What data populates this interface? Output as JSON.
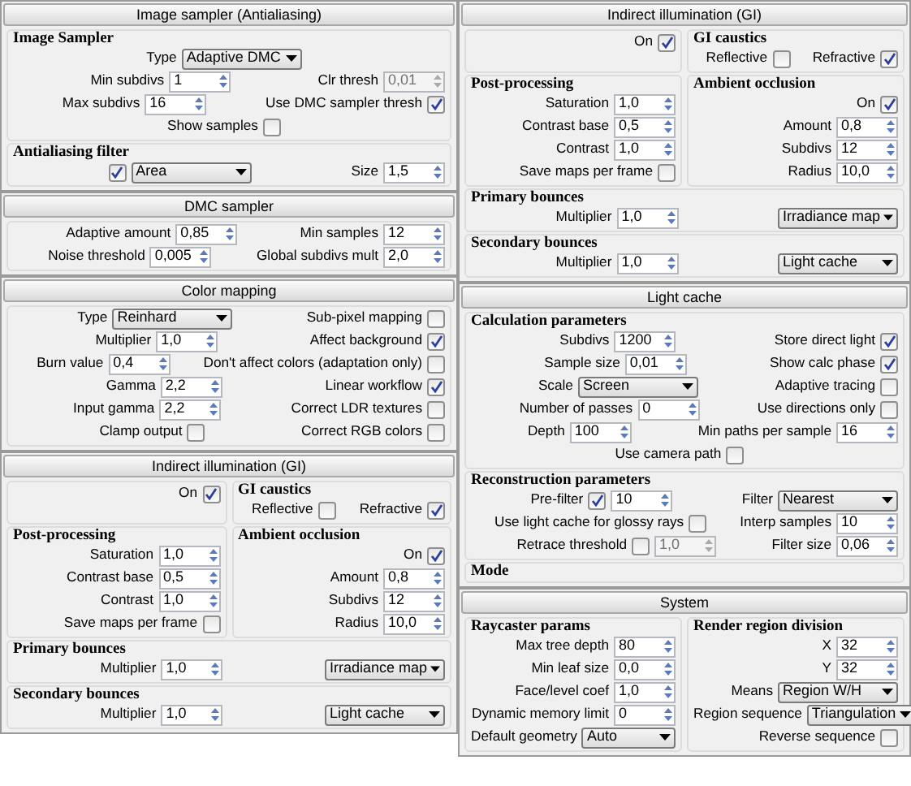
{
  "columns": [
    {
      "rollouts": [
        {
          "title": "Image sampler (Antialiasing)",
          "sections": [
            {
              "groups": [
                {
                  "title": "Image Sampler",
                  "rows": [
                    [
                      {
                        "label": "Type",
                        "controls": [
                          {
                            "kind": "combo",
                            "value": "Adaptive DMC"
                          }
                        ]
                      }
                    ],
                    [
                      {
                        "label": "Min subdivs",
                        "controls": [
                          {
                            "kind": "spin",
                            "value": "1"
                          }
                        ]
                      },
                      {
                        "label": "Clr thresh",
                        "controls": [
                          {
                            "kind": "spin",
                            "value": "0,01",
                            "disabled": true
                          }
                        ]
                      }
                    ],
                    [
                      {
                        "label": "Max subdivs",
                        "controls": [
                          {
                            "kind": "spin",
                            "value": "16"
                          }
                        ]
                      },
                      {
                        "label": "Use DMC sampler thresh",
                        "controls": [
                          {
                            "kind": "check",
                            "checked": true
                          }
                        ]
                      }
                    ],
                    [
                      {
                        "label": "Show samples",
                        "controls": [
                          {
                            "kind": "check",
                            "checked": false
                          }
                        ]
                      }
                    ]
                  ]
                }
              ]
            },
            {
              "groups": [
                {
                  "title": "Antialiasing filter",
                  "rows": [
                    [
                      {
                        "controls": [
                          {
                            "kind": "check",
                            "checked": true
                          },
                          {
                            "kind": "combo",
                            "value": "Area"
                          }
                        ]
                      },
                      {
                        "label": "Size",
                        "controls": [
                          {
                            "kind": "spin",
                            "value": "1,5"
                          }
                        ]
                      }
                    ]
                  ]
                }
              ]
            }
          ]
        },
        {
          "title": "DMC sampler",
          "sections": [
            {
              "groups": [
                {
                  "rows": [
                    [
                      {
                        "label": "Adaptive amount",
                        "controls": [
                          {
                            "kind": "spin",
                            "value": "0,85"
                          }
                        ]
                      },
                      {
                        "label": "Min samples",
                        "controls": [
                          {
                            "kind": "spin",
                            "value": "12"
                          }
                        ]
                      }
                    ],
                    [
                      {
                        "label": "Noise threshold",
                        "controls": [
                          {
                            "kind": "spin",
                            "value": "0,005"
                          }
                        ]
                      },
                      {
                        "label": "Global subdivs mult",
                        "controls": [
                          {
                            "kind": "spin",
                            "value": "2,0"
                          }
                        ]
                      }
                    ]
                  ]
                }
              ]
            }
          ]
        },
        {
          "title": "Color mapping",
          "sections": [
            {
              "groups": [
                {
                  "rows": [
                    [
                      {
                        "label": "Type",
                        "controls": [
                          {
                            "kind": "combo",
                            "value": "Reinhard"
                          }
                        ]
                      },
                      {
                        "label": "Sub-pixel mapping",
                        "controls": [
                          {
                            "kind": "check",
                            "checked": false
                          }
                        ]
                      }
                    ],
                    [
                      {
                        "label": "Multiplier",
                        "controls": [
                          {
                            "kind": "spin",
                            "value": "1,0"
                          }
                        ]
                      },
                      {
                        "label": "Affect background",
                        "controls": [
                          {
                            "kind": "check",
                            "checked": true
                          }
                        ]
                      }
                    ],
                    [
                      {
                        "label": "Burn value",
                        "controls": [
                          {
                            "kind": "spin",
                            "value": "0,4"
                          }
                        ]
                      },
                      {
                        "label": "Don't affect colors (adaptation only)",
                        "controls": [
                          {
                            "kind": "check",
                            "checked": false
                          }
                        ]
                      }
                    ],
                    [
                      {
                        "label": "Gamma",
                        "controls": [
                          {
                            "kind": "spin",
                            "value": "2,2"
                          }
                        ]
                      },
                      {
                        "label": "Linear workflow",
                        "controls": [
                          {
                            "kind": "check",
                            "checked": true
                          }
                        ]
                      }
                    ],
                    [
                      {
                        "label": "Input gamma",
                        "controls": [
                          {
                            "kind": "spin",
                            "value": "2,2"
                          }
                        ]
                      },
                      {
                        "label": "Correct LDR textures",
                        "controls": [
                          {
                            "kind": "check",
                            "checked": false
                          }
                        ]
                      }
                    ],
                    [
                      {
                        "label": "Clamp output",
                        "controls": [
                          {
                            "kind": "check",
                            "checked": false
                          }
                        ]
                      },
                      {
                        "label": "Correct RGB colors",
                        "controls": [
                          {
                            "kind": "check",
                            "checked": false
                          }
                        ]
                      }
                    ]
                  ]
                }
              ]
            }
          ]
        },
        {
          "title": "Indirect illumination (GI)",
          "sections": [
            {
              "groups": [
                {
                  "rows": [
                    [
                      {
                        "label": "On",
                        "controls": [
                          {
                            "kind": "check",
                            "checked": true
                          }
                        ]
                      }
                    ]
                  ]
                },
                {
                  "title": "GI caustics",
                  "rows": [
                    [
                      {
                        "label": "Reflective",
                        "controls": [
                          {
                            "kind": "check",
                            "checked": false
                          }
                        ]
                      },
                      {
                        "label": "Refractive",
                        "controls": [
                          {
                            "kind": "check",
                            "checked": true
                          }
                        ]
                      }
                    ]
                  ]
                }
              ]
            },
            {
              "groups": [
                {
                  "title": "Post-processing",
                  "rows": [
                    [
                      {
                        "label": "Saturation",
                        "controls": [
                          {
                            "kind": "spin",
                            "value": "1,0"
                          }
                        ]
                      }
                    ],
                    [
                      {
                        "label": "Contrast base",
                        "controls": [
                          {
                            "kind": "spin",
                            "value": "0,5"
                          }
                        ]
                      }
                    ],
                    [
                      {
                        "label": "Contrast",
                        "controls": [
                          {
                            "kind": "spin",
                            "value": "1,0"
                          }
                        ]
                      }
                    ],
                    [
                      {
                        "label": "Save maps per frame",
                        "controls": [
                          {
                            "kind": "check",
                            "checked": false
                          }
                        ]
                      }
                    ]
                  ]
                },
                {
                  "title": "Ambient occlusion",
                  "rows": [
                    [
                      {
                        "label": "On",
                        "controls": [
                          {
                            "kind": "check",
                            "checked": true
                          }
                        ]
                      }
                    ],
                    [
                      {
                        "label": "Amount",
                        "controls": [
                          {
                            "kind": "spin",
                            "value": "0,8"
                          }
                        ]
                      }
                    ],
                    [
                      {
                        "label": "Subdivs",
                        "controls": [
                          {
                            "kind": "spin",
                            "value": "12"
                          }
                        ]
                      }
                    ],
                    [
                      {
                        "label": "Radius",
                        "controls": [
                          {
                            "kind": "spin",
                            "value": "10,0"
                          }
                        ]
                      }
                    ]
                  ]
                }
              ]
            },
            {
              "groups": [
                {
                  "title": "Primary bounces",
                  "rows": [
                    [
                      {
                        "label": "Multiplier",
                        "controls": [
                          {
                            "kind": "spin",
                            "value": "1,0"
                          }
                        ]
                      },
                      {
                        "controls": [
                          {
                            "kind": "combo",
                            "value": "Irradiance map"
                          }
                        ]
                      }
                    ]
                  ]
                }
              ]
            },
            {
              "groups": [
                {
                  "title": "Secondary bounces",
                  "rows": [
                    [
                      {
                        "label": "Multiplier",
                        "controls": [
                          {
                            "kind": "spin",
                            "value": "1,0"
                          }
                        ]
                      },
                      {
                        "controls": [
                          {
                            "kind": "combo",
                            "value": "Light cache"
                          }
                        ]
                      }
                    ]
                  ]
                }
              ]
            }
          ]
        }
      ]
    },
    {
      "rollouts": [
        {
          "title": "Indirect illumination (GI)",
          "sections": [
            {
              "groups": [
                {
                  "rows": [
                    [
                      {
                        "label": "On",
                        "controls": [
                          {
                            "kind": "check",
                            "checked": true
                          }
                        ]
                      }
                    ]
                  ]
                },
                {
                  "title": "GI caustics",
                  "rows": [
                    [
                      {
                        "label": "Reflective",
                        "controls": [
                          {
                            "kind": "check",
                            "checked": false
                          }
                        ]
                      },
                      {
                        "label": "Refractive",
                        "controls": [
                          {
                            "kind": "check",
                            "checked": true
                          }
                        ]
                      }
                    ]
                  ]
                }
              ]
            },
            {
              "groups": [
                {
                  "title": "Post-processing",
                  "rows": [
                    [
                      {
                        "label": "Saturation",
                        "controls": [
                          {
                            "kind": "spin",
                            "value": "1,0"
                          }
                        ]
                      }
                    ],
                    [
                      {
                        "label": "Contrast base",
                        "controls": [
                          {
                            "kind": "spin",
                            "value": "0,5"
                          }
                        ]
                      }
                    ],
                    [
                      {
                        "label": "Contrast",
                        "controls": [
                          {
                            "kind": "spin",
                            "value": "1,0"
                          }
                        ]
                      }
                    ],
                    [
                      {
                        "label": "Save maps per frame",
                        "controls": [
                          {
                            "kind": "check",
                            "checked": false
                          }
                        ]
                      }
                    ]
                  ]
                },
                {
                  "title": "Ambient occlusion",
                  "rows": [
                    [
                      {
                        "label": "On",
                        "controls": [
                          {
                            "kind": "check",
                            "checked": true
                          }
                        ]
                      }
                    ],
                    [
                      {
                        "label": "Amount",
                        "controls": [
                          {
                            "kind": "spin",
                            "value": "0,8"
                          }
                        ]
                      }
                    ],
                    [
                      {
                        "label": "Subdivs",
                        "controls": [
                          {
                            "kind": "spin",
                            "value": "12"
                          }
                        ]
                      }
                    ],
                    [
                      {
                        "label": "Radius",
                        "controls": [
                          {
                            "kind": "spin",
                            "value": "10,0"
                          }
                        ]
                      }
                    ]
                  ]
                }
              ]
            },
            {
              "groups": [
                {
                  "title": "Primary bounces",
                  "rows": [
                    [
                      {
                        "label": "Multiplier",
                        "controls": [
                          {
                            "kind": "spin",
                            "value": "1,0"
                          }
                        ]
                      },
                      {
                        "controls": [
                          {
                            "kind": "combo",
                            "value": "Irradiance map"
                          }
                        ]
                      }
                    ]
                  ]
                }
              ]
            },
            {
              "groups": [
                {
                  "title": "Secondary bounces",
                  "rows": [
                    [
                      {
                        "label": "Multiplier",
                        "controls": [
                          {
                            "kind": "spin",
                            "value": "1,0"
                          }
                        ]
                      },
                      {
                        "controls": [
                          {
                            "kind": "combo",
                            "value": "Light cache"
                          }
                        ]
                      }
                    ]
                  ]
                }
              ]
            }
          ]
        },
        {
          "title": "Light cache",
          "sections": [
            {
              "groups": [
                {
                  "title": "Calculation parameters",
                  "rows": [
                    [
                      {
                        "label": "Subdivs",
                        "controls": [
                          {
                            "kind": "spin",
                            "value": "1200"
                          }
                        ]
                      },
                      {
                        "label": "Store direct light",
                        "controls": [
                          {
                            "kind": "check",
                            "checked": true
                          }
                        ]
                      }
                    ],
                    [
                      {
                        "label": "Sample size",
                        "controls": [
                          {
                            "kind": "spin",
                            "value": "0,01"
                          }
                        ]
                      },
                      {
                        "label": "Show calc phase",
                        "controls": [
                          {
                            "kind": "check",
                            "checked": true
                          }
                        ]
                      }
                    ],
                    [
                      {
                        "label": "Scale",
                        "controls": [
                          {
                            "kind": "combo",
                            "value": "Screen"
                          }
                        ]
                      },
                      {
                        "label": "Adaptive tracing",
                        "controls": [
                          {
                            "kind": "check",
                            "checked": false
                          }
                        ]
                      }
                    ],
                    [
                      {
                        "label": "Number of passes",
                        "controls": [
                          {
                            "kind": "spin",
                            "value": "0"
                          }
                        ]
                      },
                      {
                        "label": "Use directions only",
                        "controls": [
                          {
                            "kind": "check",
                            "checked": false
                          }
                        ]
                      }
                    ],
                    [
                      {
                        "label": "Depth",
                        "controls": [
                          {
                            "kind": "spin",
                            "value": "100"
                          }
                        ]
                      },
                      {
                        "label": "Min paths per sample",
                        "controls": [
                          {
                            "kind": "spin",
                            "value": "16"
                          }
                        ]
                      }
                    ],
                    [
                      {
                        "label": "Use camera path",
                        "controls": [
                          {
                            "kind": "check",
                            "checked": false
                          }
                        ]
                      }
                    ]
                  ]
                }
              ]
            },
            {
              "groups": [
                {
                  "title": "Reconstruction parameters",
                  "rows": [
                    [
                      {
                        "label": "Pre-filter",
                        "controls": [
                          {
                            "kind": "check",
                            "checked": true
                          },
                          {
                            "kind": "spin",
                            "value": "10"
                          }
                        ]
                      },
                      {
                        "label": "Filter",
                        "controls": [
                          {
                            "kind": "combo",
                            "value": "Nearest"
                          }
                        ]
                      }
                    ],
                    [
                      {
                        "label": "Use light cache for glossy rays",
                        "controls": [
                          {
                            "kind": "check",
                            "checked": false
                          }
                        ]
                      },
                      {
                        "label": "Interp samples",
                        "controls": [
                          {
                            "kind": "spin",
                            "value": "10"
                          }
                        ]
                      }
                    ],
                    [
                      {
                        "label": "Retrace threshold",
                        "controls": [
                          {
                            "kind": "check",
                            "checked": false
                          },
                          {
                            "kind": "spin",
                            "value": "1,0",
                            "disabled": true
                          }
                        ]
                      },
                      {
                        "label": "Filter size",
                        "controls": [
                          {
                            "kind": "spin",
                            "value": "0,06"
                          }
                        ]
                      }
                    ]
                  ]
                }
              ]
            },
            {
              "groups": [
                {
                  "title": "Mode"
                }
              ]
            }
          ]
        },
        {
          "title": "System",
          "sections": [
            {
              "groups": [
                {
                  "title": "Raycaster params",
                  "rows": [
                    [
                      {
                        "label": "Max tree depth",
                        "controls": [
                          {
                            "kind": "spin",
                            "value": "80"
                          }
                        ]
                      }
                    ],
                    [
                      {
                        "label": "Min leaf size",
                        "controls": [
                          {
                            "kind": "spin",
                            "value": "0,0"
                          }
                        ]
                      }
                    ],
                    [
                      {
                        "label": "Face/level coef",
                        "controls": [
                          {
                            "kind": "spin",
                            "value": "1,0"
                          }
                        ]
                      }
                    ],
                    [
                      {
                        "label": "Dynamic memory limit",
                        "controls": [
                          {
                            "kind": "spin",
                            "value": "0"
                          }
                        ]
                      }
                    ],
                    [
                      {
                        "label": "Default geometry",
                        "controls": [
                          {
                            "kind": "combo",
                            "value": "Auto"
                          }
                        ]
                      }
                    ]
                  ]
                },
                {
                  "title": "Render region division",
                  "rows": [
                    [
                      {
                        "label": "X",
                        "controls": [
                          {
                            "kind": "spin",
                            "value": "32"
                          }
                        ]
                      }
                    ],
                    [
                      {
                        "label": "Y",
                        "controls": [
                          {
                            "kind": "spin",
                            "value": "32"
                          }
                        ]
                      }
                    ],
                    [
                      {
                        "label": "Means",
                        "controls": [
                          {
                            "kind": "combo",
                            "value": "Region W/H"
                          }
                        ]
                      }
                    ],
                    [
                      {
                        "label": "Region sequence",
                        "controls": [
                          {
                            "kind": "combo",
                            "value": "Triangulation"
                          }
                        ]
                      }
                    ],
                    [
                      {
                        "label": "Reverse sequence",
                        "controls": [
                          {
                            "kind": "check",
                            "checked": false
                          }
                        ]
                      }
                    ]
                  ]
                }
              ]
            }
          ]
        }
      ]
    }
  ]
}
